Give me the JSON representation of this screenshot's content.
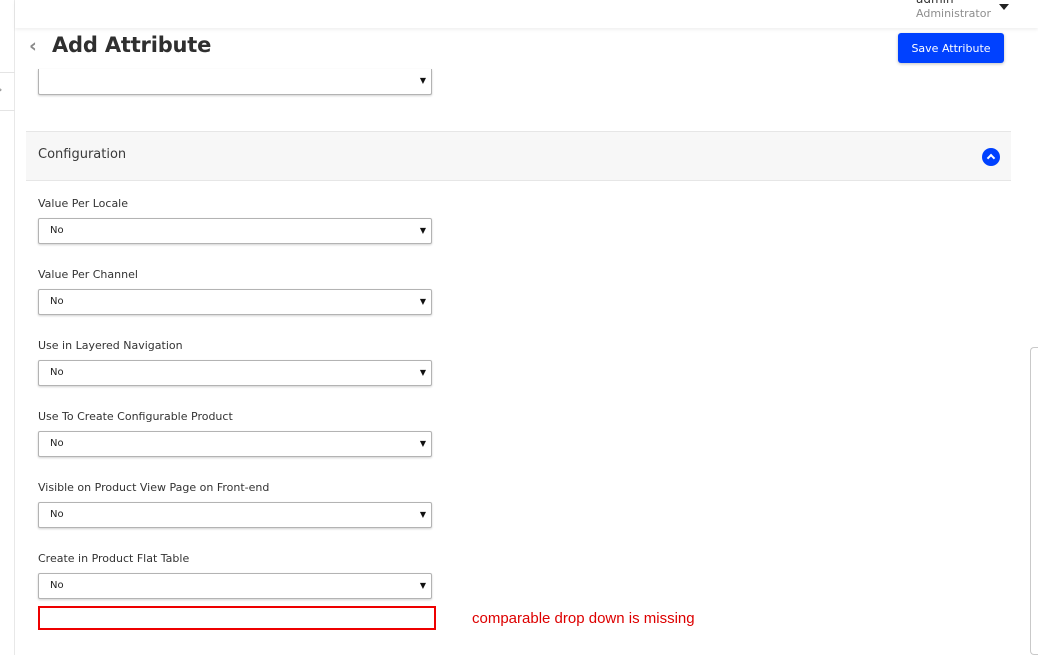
{
  "header": {
    "user_name": "admin",
    "user_role": "Administrator",
    "user_caret_icon": "caret-down-icon"
  },
  "page": {
    "back_icon": "‹",
    "title": "Add Attribute",
    "save_label": "Save Attribute",
    "accent_color": "#0041ff"
  },
  "top_select": {
    "value": ""
  },
  "configuration": {
    "title": "Configuration",
    "collapse_icon": "chevron-up-circle-icon",
    "fields": [
      {
        "label": "Value Per Locale",
        "value": "No"
      },
      {
        "label": "Value Per Channel",
        "value": "No"
      },
      {
        "label": "Use in Layered Navigation",
        "value": "No"
      },
      {
        "label": "Use To Create Configurable Product",
        "value": "No"
      },
      {
        "label": "Visible on Product View Page on Front-end",
        "value": "No"
      },
      {
        "label": "Create in Product Flat Table",
        "value": "No"
      }
    ]
  },
  "annotation": {
    "note": "comparable drop down is missing",
    "color": "#dd0000"
  },
  "select_arrow": "▼"
}
